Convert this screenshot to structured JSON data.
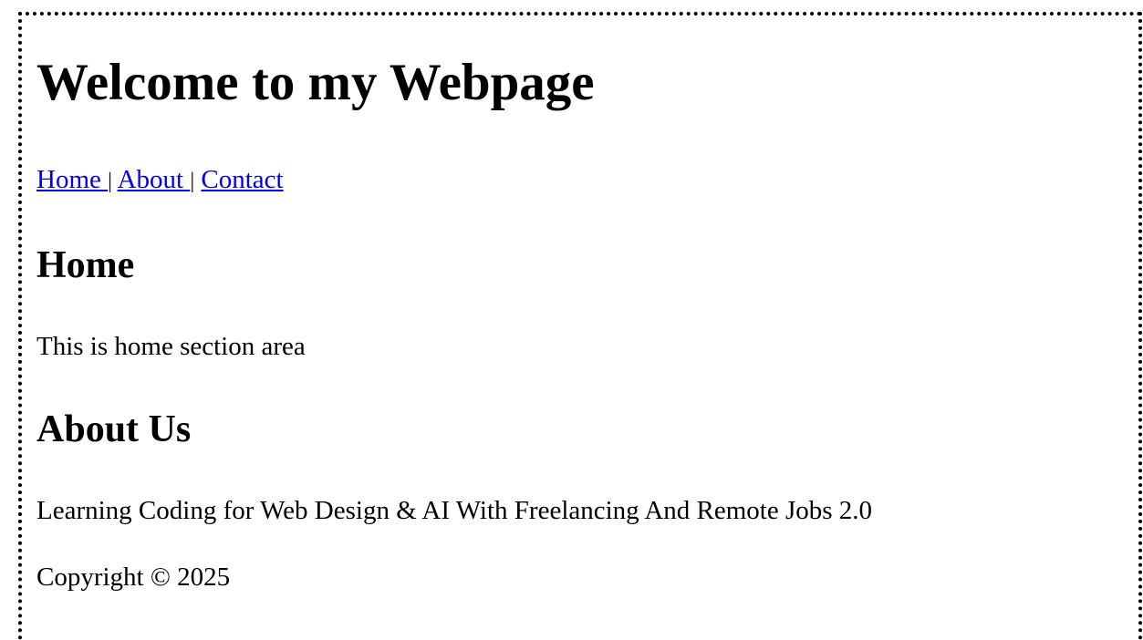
{
  "header": {
    "title": "Welcome to my Webpage"
  },
  "nav": {
    "links": [
      {
        "label": "Home "
      },
      {
        "label": "About "
      },
      {
        "label": "Contact"
      }
    ],
    "separator": "|"
  },
  "home": {
    "heading": "Home",
    "text": "This is home section area"
  },
  "about": {
    "heading": "About Us",
    "text": "Learning Coding for Web Design & AI With Freelancing And Remote Jobs 2.0"
  },
  "footer": {
    "copyright": "Copyright © 2025"
  },
  "colors": {
    "link": "#0000ee",
    "text": "#000000",
    "background": "#ffffff"
  }
}
